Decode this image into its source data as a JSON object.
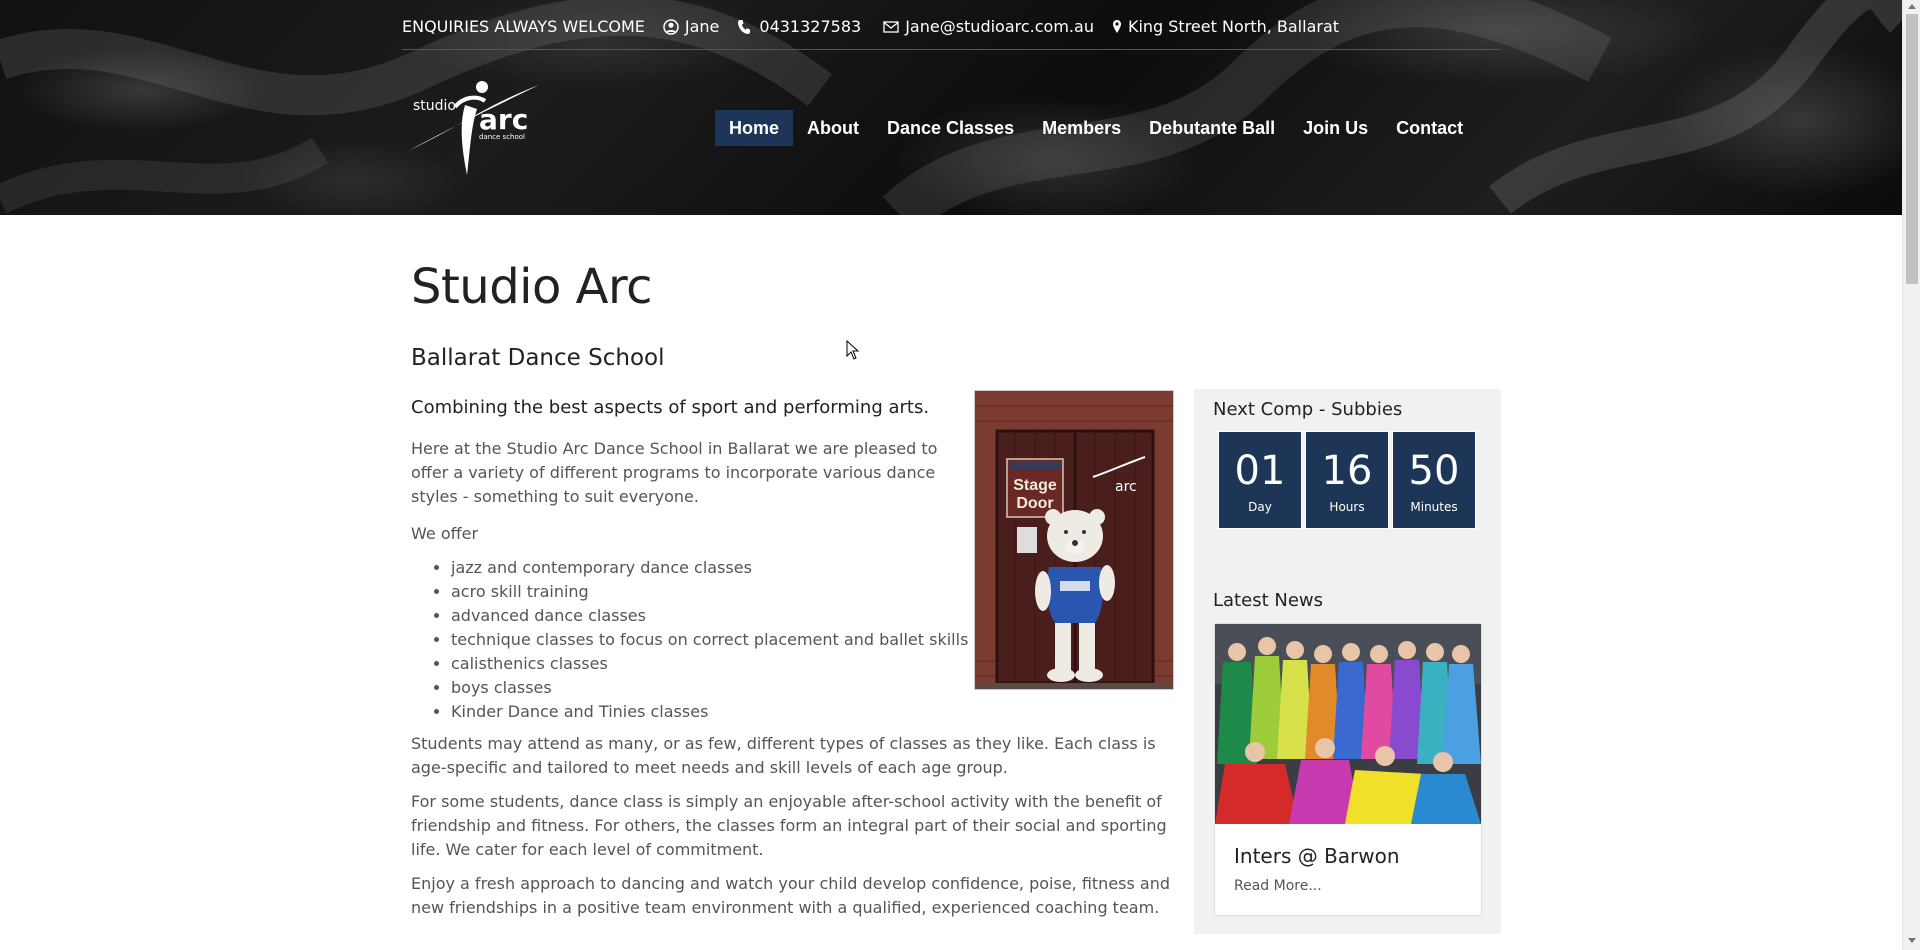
{
  "topbar": {
    "enquiries": "ENQUIRIES ALWAYS WELCOME",
    "contact_name": "Jane",
    "phone": "0431327583",
    "email": "Jane@studioarc.com.au",
    "location": "King Street North, Ballarat",
    "icons": [
      "user-circle-icon",
      "phone-icon",
      "envelope-icon",
      "map-marker-icon"
    ]
  },
  "logo": {
    "studio": "studio",
    "arc": "arc",
    "school": "dance school"
  },
  "nav": {
    "items": [
      {
        "label": "Home",
        "active": true
      },
      {
        "label": "About",
        "active": false
      },
      {
        "label": "Dance Classes",
        "active": false
      },
      {
        "label": "Members",
        "active": false
      },
      {
        "label": "Debutante Ball",
        "active": false
      },
      {
        "label": "Join Us",
        "active": false
      },
      {
        "label": "Contact",
        "active": false
      }
    ]
  },
  "main": {
    "title": "Studio Arc",
    "subtitle": "Ballarat Dance School",
    "tagline": "Combining the best aspects of sport and performing arts.",
    "intro": "Here at the Studio Arc Dance School in Ballarat we are pleased to offer a variety of different programs to incorporate various dance styles - something to suit everyone.",
    "we_offer": "We offer",
    "offerings": [
      "jazz and contemporary dance classes",
      "acro skill training",
      "advanced dance classes",
      "technique classes to focus on correct placement and ballet skills",
      "calisthenics classes",
      "boys classes",
      "Kinder Dance and Tinies classes"
    ],
    "p1": "Students may attend as many, or as few, different types of classes as they like.  Each class is age-specific and tailored to meet needs and skill levels of each age group.",
    "p2": "For some students, dance class is simply an enjoyable after-school activity with the benefit of friendship and fitness.  For others, the classes form an integral part of their social and sporting life.  We cater for each level of commitment.",
    "p3": "Enjoy a fresh approach to dancing and watch your child develop confidence, poise, fitness and new friendships in a positive team environment with a qualified, experienced coaching team.",
    "photo": {
      "sign_line1": "Stage",
      "sign_line2": "Door",
      "logo_text": "arc"
    }
  },
  "sidebar": {
    "next_comp_title": "Next Comp - Subbies",
    "countdown": [
      {
        "value": "01",
        "unit": "Day"
      },
      {
        "value": "16",
        "unit": "Hours"
      },
      {
        "value": "50",
        "unit": "Minutes"
      }
    ],
    "latest_news_title": "Latest News",
    "news": {
      "title": "Inters @ Barwon",
      "read_more": "Read More..."
    }
  },
  "colors": {
    "accent": "#1d3557",
    "header_bg": "#111111",
    "sidebar_bg": "#f1f1f1"
  }
}
